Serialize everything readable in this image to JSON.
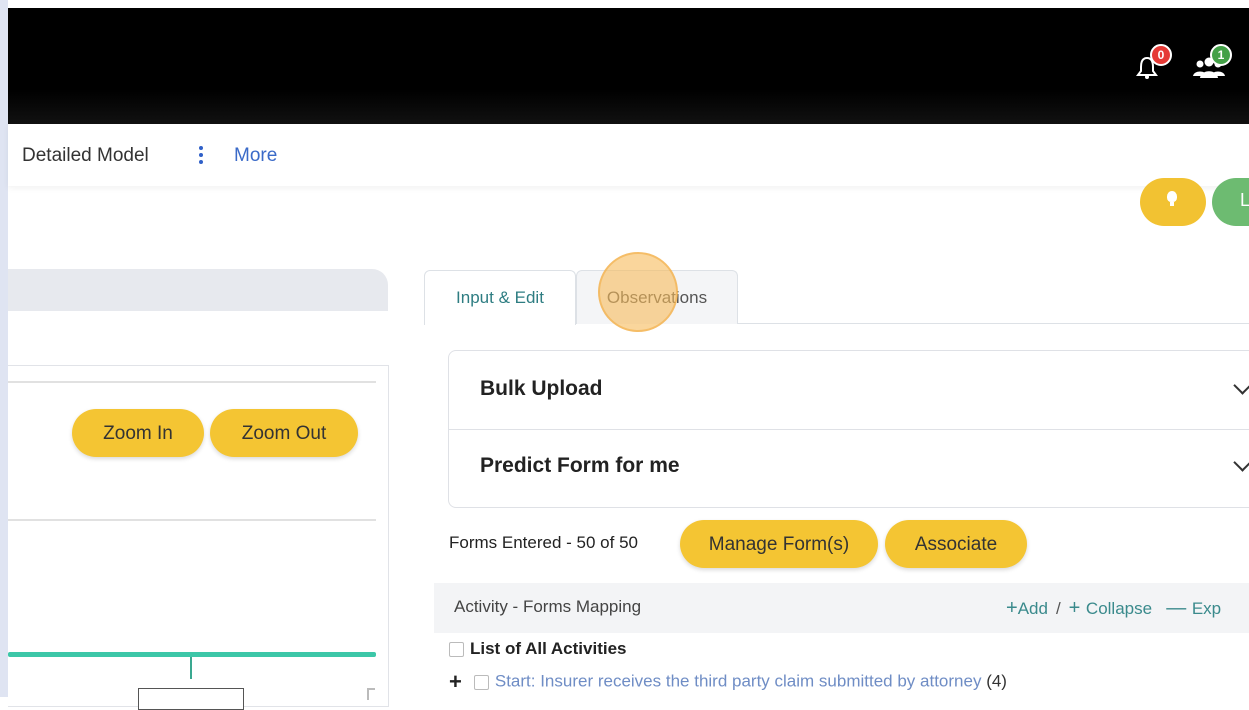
{
  "header": {
    "notifications": {
      "icon": "bell-icon",
      "count": "0",
      "badge_color": "#e53935"
    },
    "users": {
      "icon": "users-icon",
      "count": "1",
      "badge_color": "#43a047"
    }
  },
  "nav": {
    "model_label": "Detailed Model",
    "more_icon": "kebab-menu-icon",
    "more_label": "More"
  },
  "top_right": {
    "hint_icon": "lightbulb-icon",
    "green_label": "L"
  },
  "diagram": {
    "zoom_in": "Zoom In",
    "zoom_out": "Zoom Out"
  },
  "tabs": [
    {
      "label": "Input & Edit",
      "active": true
    },
    {
      "label": "Observations",
      "active": false
    }
  ],
  "accordion": [
    {
      "label": "Bulk Upload",
      "icon": "chevron-down-icon"
    },
    {
      "label": "Predict Form for me",
      "icon": "chevron-down-icon"
    }
  ],
  "forms": {
    "count_label": "Forms Entered - 50 of 50",
    "manage_label": "Manage Form(s)",
    "associate_label": "Associate"
  },
  "mapping": {
    "title": "Activity - Forms Mapping",
    "add_label": "Add",
    "collapse_label": "Collapse",
    "expand_label": "Exp",
    "list_all_label": "List of All Activities",
    "rows": [
      {
        "text": "Start: Insurer receives the third party claim submitted by attorney",
        "count": "(4)"
      }
    ]
  },
  "colors": {
    "accent_yellow": "#f4c533",
    "accent_teal": "#2e7d82",
    "flow_line": "#3cc7a8"
  }
}
